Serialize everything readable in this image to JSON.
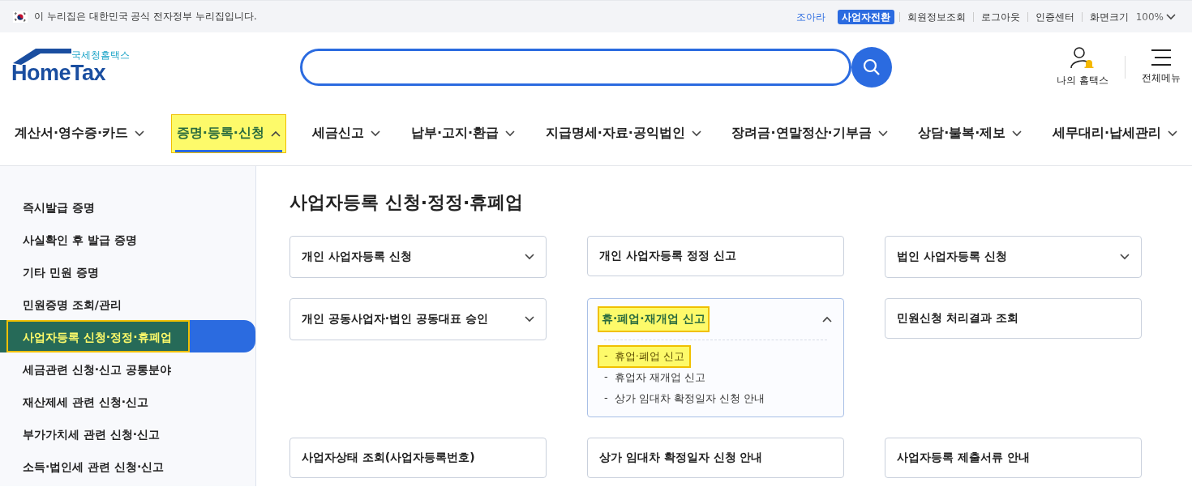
{
  "top_bar": {
    "notice": "이 누리집은 대한민국 공식 전자정부 누리집입니다.",
    "links": [
      {
        "label": "조아라",
        "kind": "link"
      },
      {
        "label": "사업자전환",
        "kind": "badge"
      },
      {
        "label": "회원정보조회",
        "kind": "plain"
      },
      {
        "label": "로그아웃",
        "kind": "plain"
      },
      {
        "label": "인증센터",
        "kind": "plain"
      }
    ],
    "zoom_label": "화면크기",
    "zoom_value": "100%"
  },
  "header": {
    "logo_small": "국세청홈택스",
    "logo": "HomeTax",
    "my_menu": "나의 홈택스",
    "all_menu": "전체메뉴"
  },
  "nav": [
    {
      "label": "계산서·영수증·카드",
      "selected": false,
      "expanded": false,
      "highlighted": false
    },
    {
      "label": "증명·등록·신청",
      "selected": true,
      "expanded": true,
      "highlighted": true
    },
    {
      "label": "세금신고",
      "selected": false,
      "expanded": false,
      "highlighted": false
    },
    {
      "label": "납부·고지·환급",
      "selected": false,
      "expanded": false,
      "highlighted": false
    },
    {
      "label": "지급명세·자료·공익법인",
      "selected": false,
      "expanded": false,
      "highlighted": false
    },
    {
      "label": "장려금·연말정산·기부금",
      "selected": false,
      "expanded": false,
      "highlighted": false
    },
    {
      "label": "상담·불복·제보",
      "selected": false,
      "expanded": false,
      "highlighted": false
    },
    {
      "label": "세무대리·납세관리",
      "selected": false,
      "expanded": false,
      "highlighted": false
    }
  ],
  "sidebar": {
    "items": [
      {
        "label": "즉시발급 증명",
        "selected": false,
        "highlighted": false
      },
      {
        "label": "사실확인 후 발급 증명",
        "selected": false,
        "highlighted": false
      },
      {
        "label": "기타 민원 증명",
        "selected": false,
        "highlighted": false
      },
      {
        "label": "민원증명 조회/관리",
        "selected": false,
        "highlighted": false
      },
      {
        "label": "사업자등록 신청·정정·휴폐업",
        "selected": true,
        "highlighted": true
      },
      {
        "label": "세금관련 신청·신고 공통분야",
        "selected": false,
        "highlighted": false
      },
      {
        "label": "재산제세 관련 신청·신고",
        "selected": false,
        "highlighted": false
      },
      {
        "label": "부가가치세 관련 신청·신고",
        "selected": false,
        "highlighted": false
      },
      {
        "label": "소득·법인세 관련 신청·신고",
        "selected": false,
        "highlighted": false
      }
    ]
  },
  "main": {
    "title": "사업자등록 신청·정정·휴폐업",
    "cards": [
      {
        "title": "개인 사업자등록 신청",
        "kind": "expandable",
        "expanded": false,
        "highlighted": false
      },
      {
        "title": "개인 사업자등록 정정 신고",
        "kind": "plain"
      },
      {
        "title": "법인 사업자등록 신청",
        "kind": "expandable",
        "expanded": false,
        "highlighted": false
      },
      {
        "title": "개인 공동사업자·법인 공동대표 승인",
        "kind": "expandable",
        "expanded": false,
        "highlighted": false
      },
      {
        "title": "휴·폐업·재개업 신고",
        "kind": "expandable",
        "expanded": true,
        "highlighted": true,
        "children": [
          {
            "bullet": "-",
            "label": "휴업·폐업 신고",
            "highlighted": true
          },
          {
            "bullet": "-",
            "label": "휴업자 재개업 신고",
            "highlighted": false
          },
          {
            "bullet": "-",
            "label": "상가 임대차 확정일자 신청 안내",
            "highlighted": false
          }
        ]
      },
      {
        "title": "민원신청 처리결과 조회",
        "kind": "plain"
      },
      {
        "title": "사업자상태 조회(사업자등록번호)",
        "kind": "plain"
      },
      {
        "title": "상가 임대차 확정일자 신청 안내",
        "kind": "plain"
      },
      {
        "title": "사업자등록 제출서류 안내",
        "kind": "plain"
      }
    ]
  }
}
